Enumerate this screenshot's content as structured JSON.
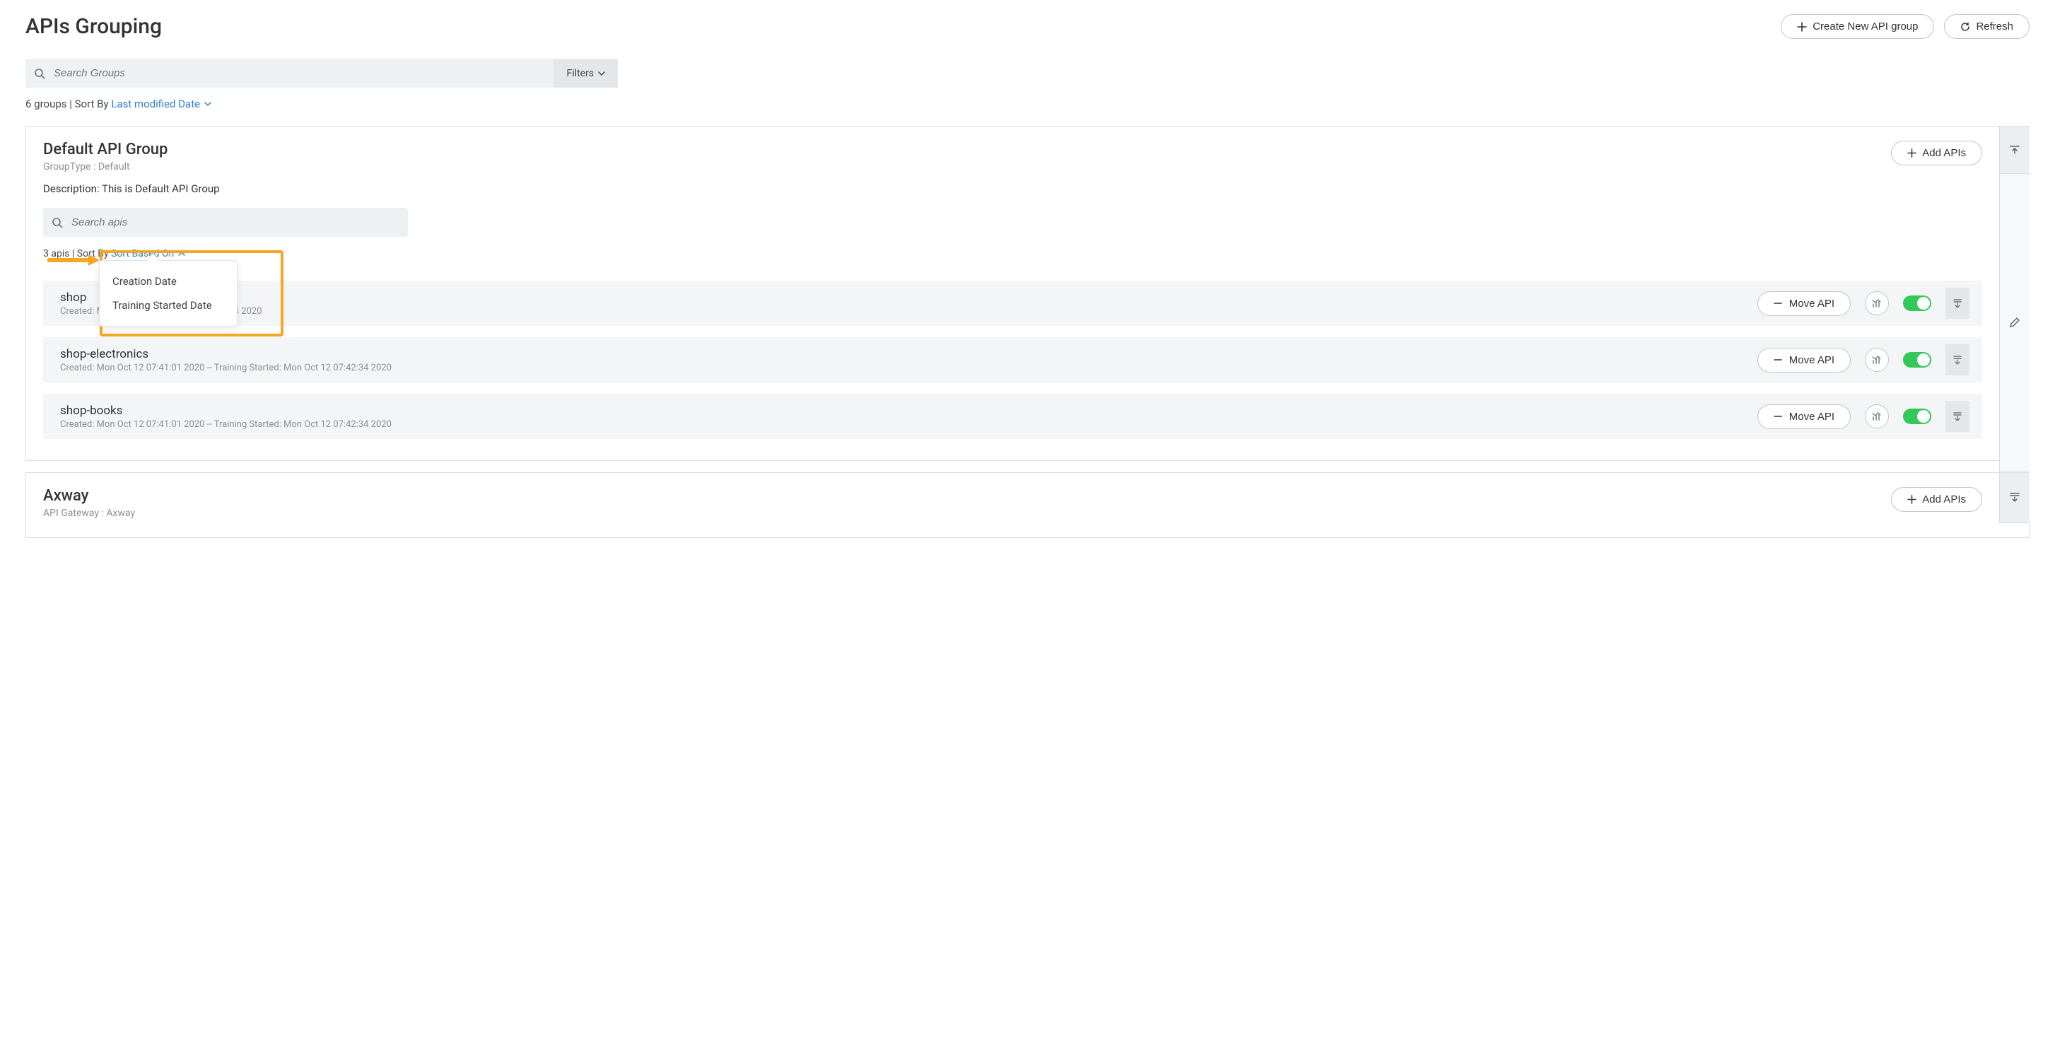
{
  "page": {
    "title": "APIs Grouping",
    "create_btn": "Create New API group",
    "refresh_btn": "Refresh",
    "search_placeholder": "Search Groups",
    "filters_label": "Filters",
    "groups_count_prefix": "6 groups | Sort By",
    "sort_label": "Last modified Date"
  },
  "group1": {
    "title": "Default API Group",
    "sub": "GroupType : Default",
    "desc": "Description: This is Default API Group",
    "add_apis_btn": "Add APIs",
    "search_apis_placeholder": "Search apis",
    "apis_count_prefix": "3 apis | Sort By",
    "sort_label": "Sort Based On",
    "move_api_btn": "Move API",
    "apis": [
      {
        "name": "shop",
        "meta": "Created: Mo                                               g Started: Mon Oct 12 07:42:34 2020"
      },
      {
        "name": "shop-electronics",
        "meta": "Created: Mon Oct 12 07:41:01 2020 -- Training Started: Mon Oct 12 07:42:34 2020"
      },
      {
        "name": "shop-books",
        "meta": "Created: Mon Oct 12 07:41:01 2020 -- Training Started: Mon Oct 12 07:42:34 2020"
      }
    ],
    "dropdown": {
      "item1": "Creation Date",
      "item2": "Training Started Date"
    }
  },
  "group2": {
    "title": "Axway",
    "sub": "API Gateway : Axway",
    "add_apis_btn": "Add APIs"
  }
}
